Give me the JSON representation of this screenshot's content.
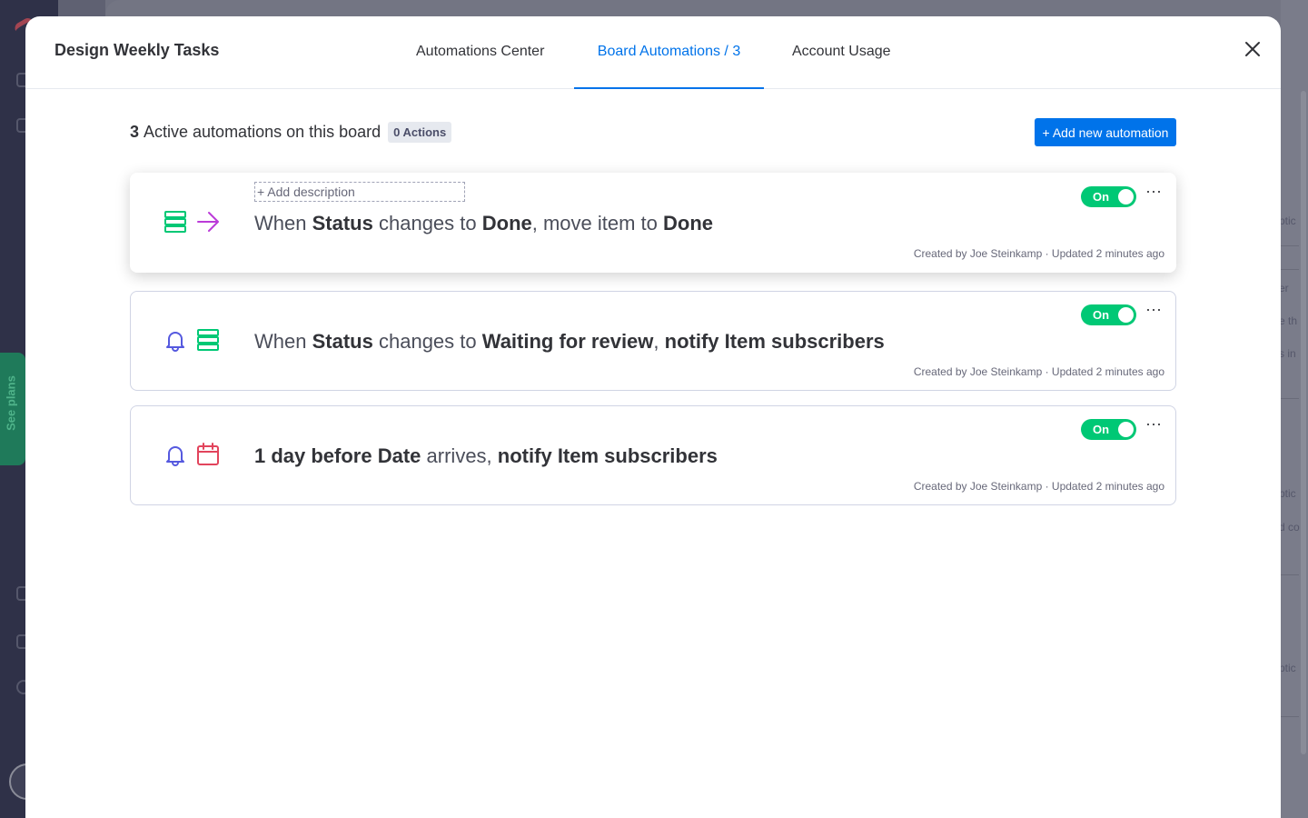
{
  "background": {
    "see_plans_label": "See plans",
    "right_fragments": [
      "ptic",
      "er",
      "e th",
      "s in",
      "ptic",
      "d co",
      "ptic"
    ]
  },
  "header": {
    "board_title": "Design Weekly Tasks",
    "tabs": [
      {
        "label": "Automations Center",
        "active": false
      },
      {
        "label": "Board Automations / 3",
        "active": true
      },
      {
        "label": "Account Usage",
        "active": false
      }
    ],
    "close_icon": "close-icon"
  },
  "summary": {
    "count": "3",
    "text": "Active automations on this board",
    "actions_badge": "0 Actions"
  },
  "add_button_label": "+ Add new automation",
  "add_description_label": "+ Add description",
  "automations": [
    {
      "icons": [
        "board-icon",
        "arrow-right-icon"
      ],
      "sentence": {
        "p1": "When",
        "b1": "Status",
        "p2": "changes to",
        "b2": "Done",
        "p3": ", move item to",
        "b3": "Done"
      },
      "toggle": "On",
      "meta": "Created by Joe Steinkamp · Updated 2 minutes ago"
    },
    {
      "icons": [
        "bell-icon",
        "board-icon"
      ],
      "sentence": {
        "p1": "When",
        "b1": "Status",
        "p2": "changes to",
        "b2": "Waiting for review",
        "p3": ",",
        "b3": "notify",
        "b4": "Item subscribers"
      },
      "toggle": "On",
      "meta": "Created by Joe Steinkamp · Updated 2 minutes ago"
    },
    {
      "icons": [
        "bell-icon",
        "calendar-icon"
      ],
      "sentence": {
        "b1": "1 day before",
        "b2": "Date",
        "p1": "arrives,",
        "b3": "notify",
        "b4": "Item subscribers"
      },
      "toggle": "On",
      "meta": "Created by Joe Steinkamp · Updated 2 minutes ago"
    }
  ],
  "colors": {
    "accent": "#0073ea",
    "toggle_on": "#00c875",
    "board_icon": "#00c875",
    "bell_icon": "#5559df",
    "arrow_icon": "#bb3bd8",
    "calendar_icon": "#e2445c"
  }
}
